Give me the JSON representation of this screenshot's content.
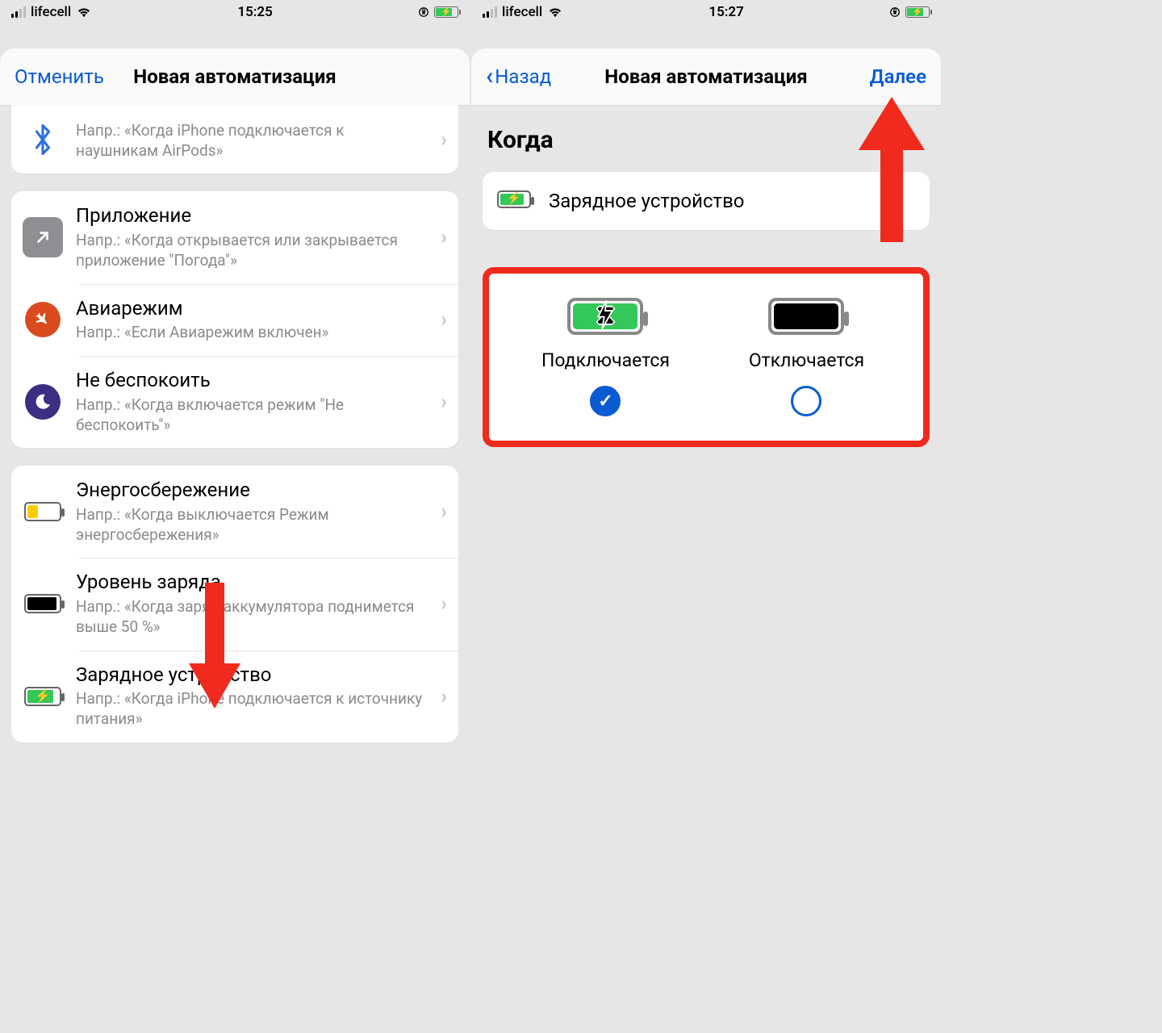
{
  "left": {
    "status": {
      "carrier": "lifecell",
      "time": "15:25"
    },
    "nav": {
      "cancel": "Отменить",
      "title": "Новая автоматизация"
    },
    "partial_row": {
      "sub": "Напр.: «Когда iPhone подключается к наушникам AirPods»"
    },
    "group2": [
      {
        "title": "Приложение",
        "sub": "Напр.: «Когда открывается или закрывается приложение \"Погода\"»"
      },
      {
        "title": "Авиарежим",
        "sub": "Напр.: «Если Авиарежим включен»"
      },
      {
        "title": "Не беспокоить",
        "sub": "Напр.: «Когда включается режим \"Не беспокоить\"»"
      }
    ],
    "group3": [
      {
        "title": "Энергосбережение",
        "sub": "Напр.: «Когда выключается Режим энергосбережения»"
      },
      {
        "title": "Уровень заряда",
        "sub": "Напр.: «Когда заряд аккумулятора поднимется выше 50 %»"
      },
      {
        "title": "Зарядное устройство",
        "sub": "Напр.: «Когда iPhone подключается к источнику питания»"
      }
    ]
  },
  "right": {
    "status": {
      "carrier": "lifecell",
      "time": "15:27"
    },
    "nav": {
      "back": "Назад",
      "title": "Новая автоматизация",
      "next": "Далее"
    },
    "section": "Когда",
    "trigger_label": "Зарядное устройство",
    "options": {
      "connect": "Подключается",
      "disconnect": "Отключается"
    }
  }
}
